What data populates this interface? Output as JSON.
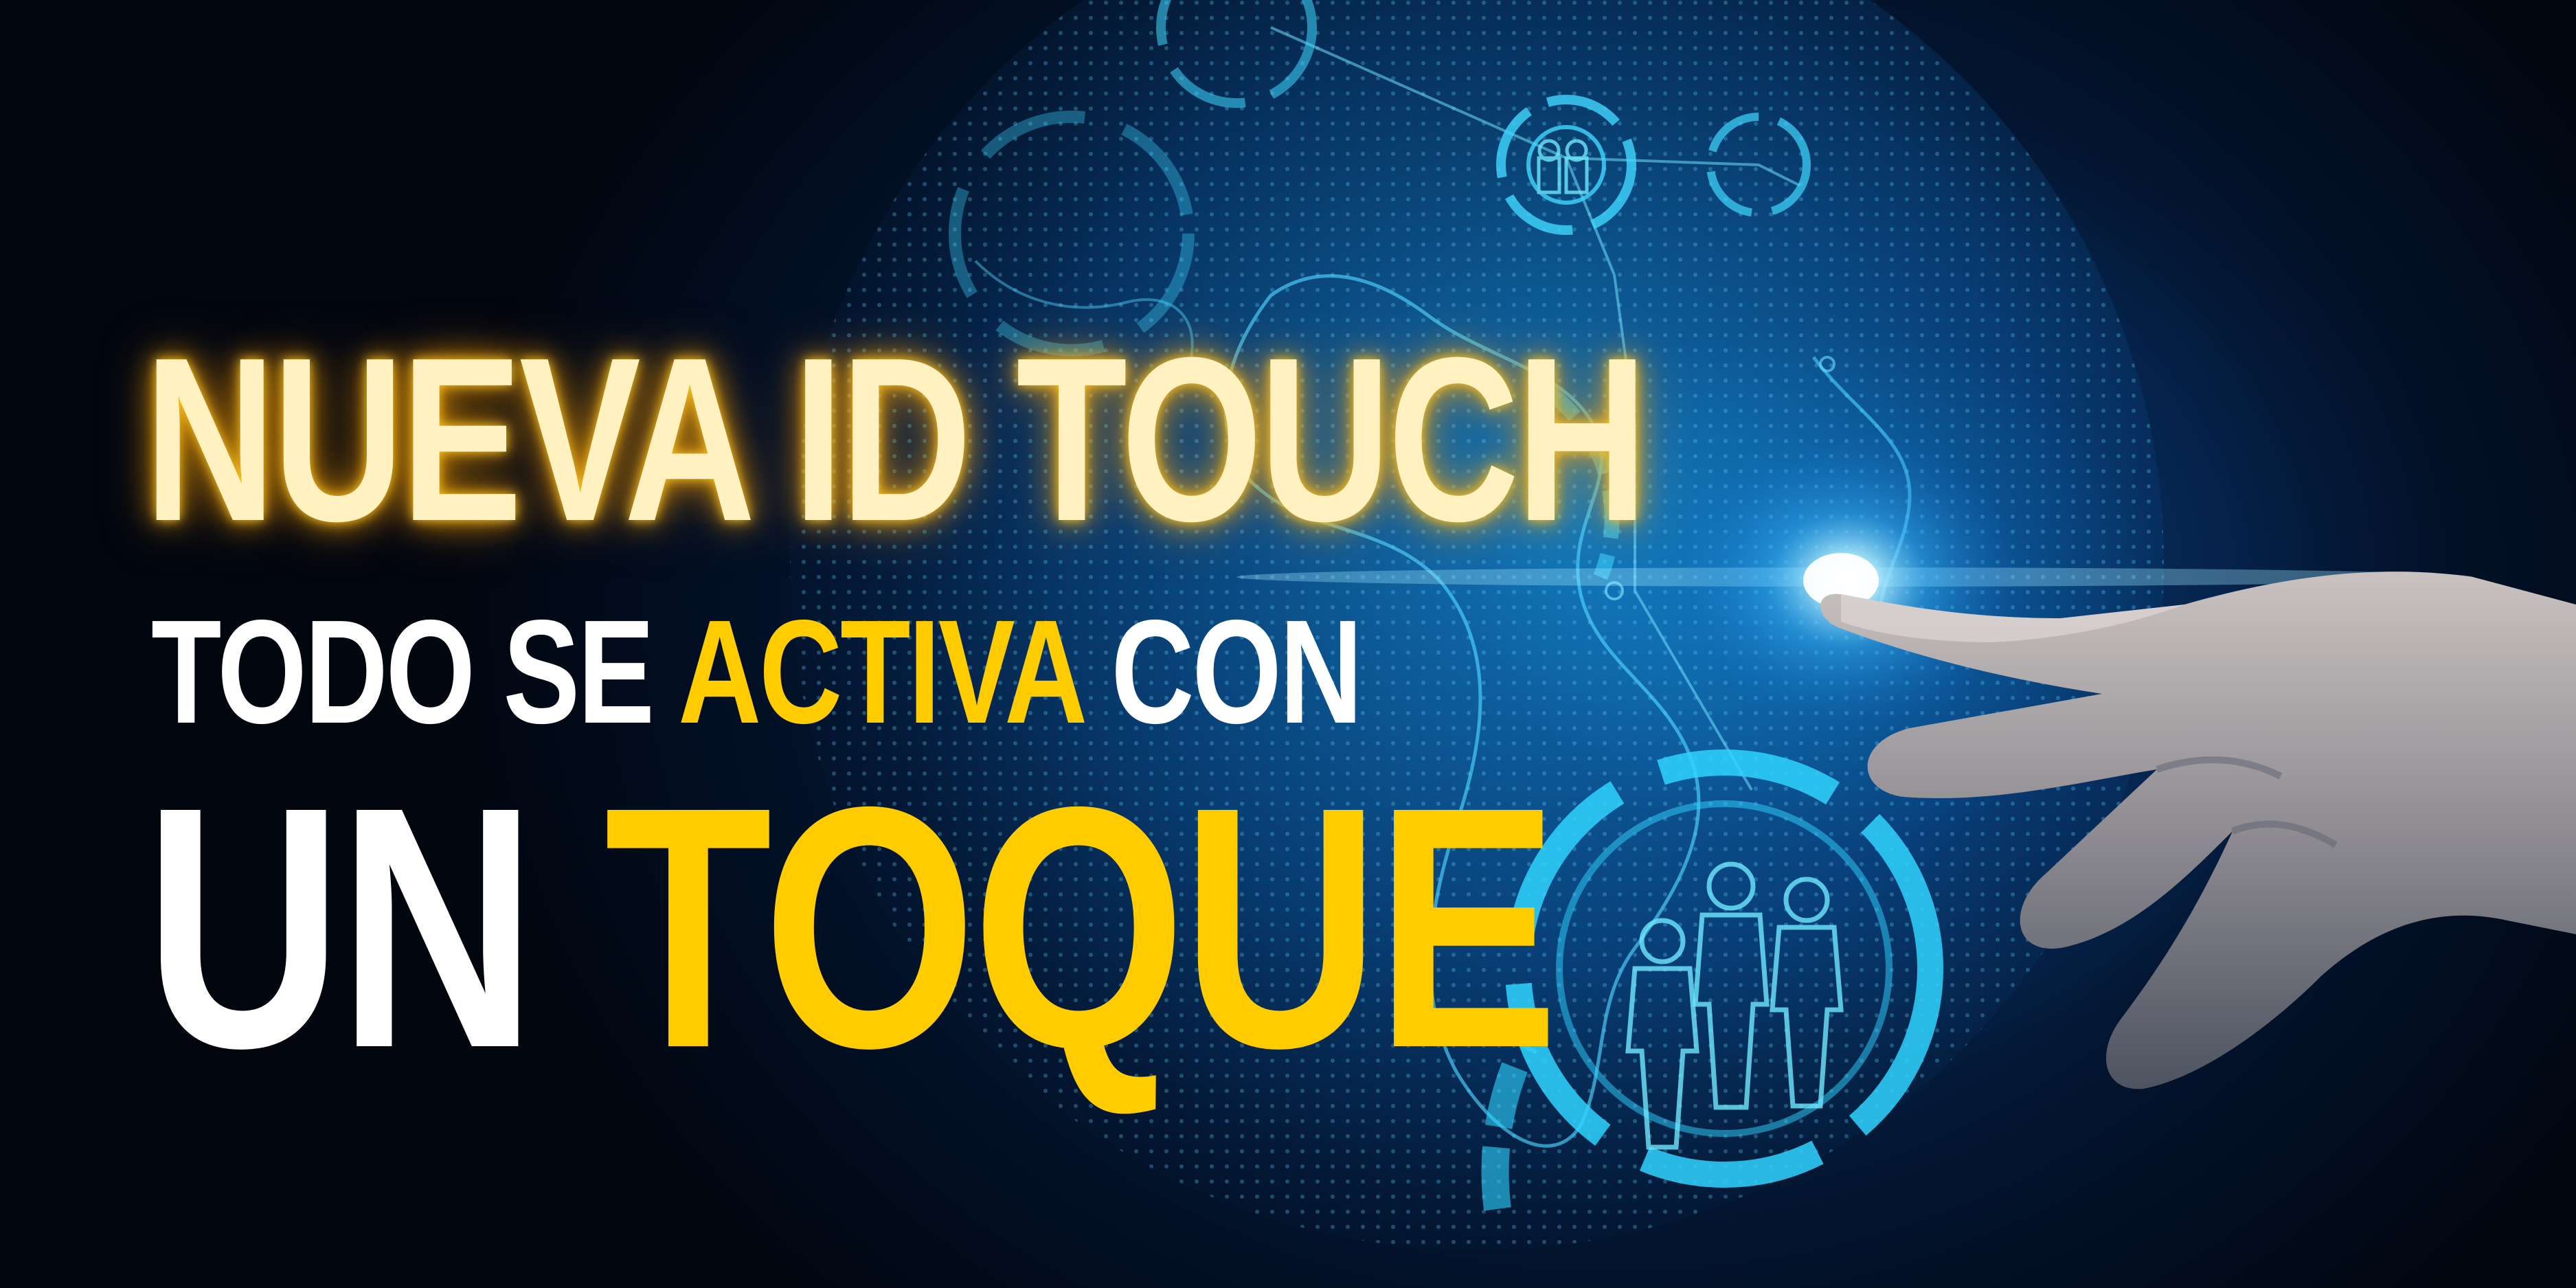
{
  "headline": {
    "line1": "NUEVA ID TOUCH",
    "line2_part1": "TODO SE ",
    "line2_highlight": "ACTIVA",
    "line2_part2": " CON",
    "line3_part1": "UN ",
    "line3_highlight": "TOQUE"
  },
  "colors": {
    "accent_yellow": "#ffcc00",
    "glow_text": "#fff2c0",
    "background_dark": "#02060d",
    "hologram_cyan": "#3fd8ff"
  },
  "icons": [
    "globe-hologram",
    "people-group-icon",
    "pointing-hand"
  ]
}
